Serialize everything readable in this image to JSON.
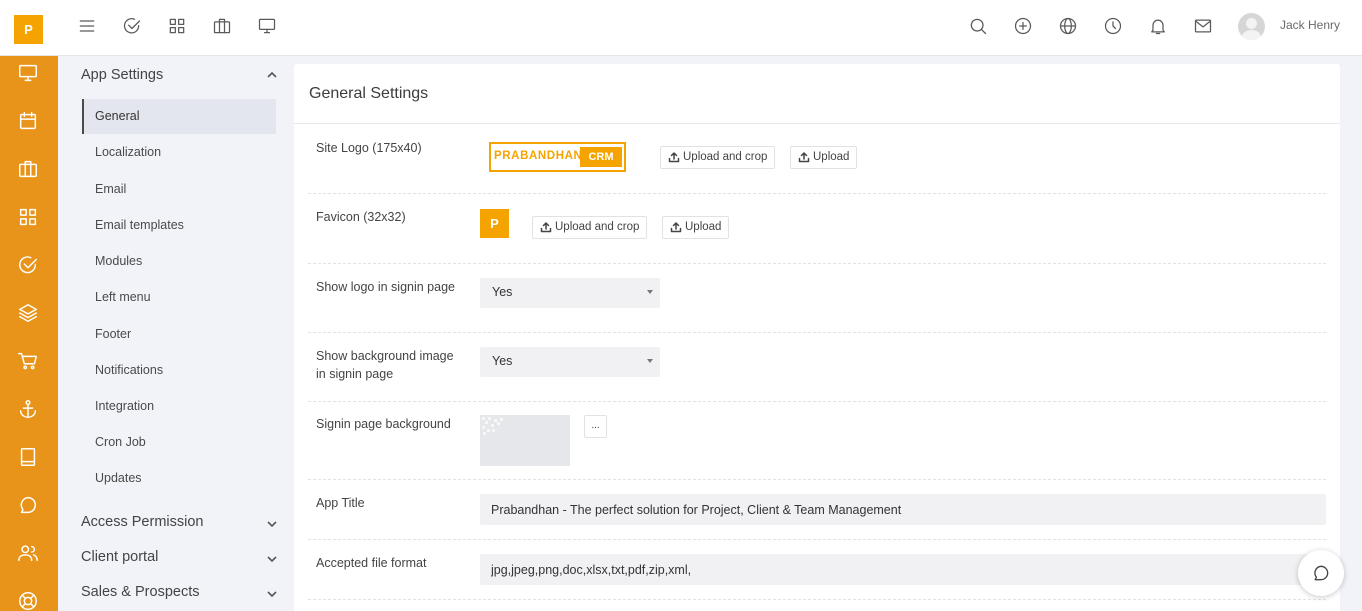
{
  "brand": {
    "letter": "P"
  },
  "rail": {
    "items": [
      "monitor-icon",
      "calendar-icon",
      "briefcase-icon",
      "grid-icon",
      "check-circle-icon",
      "layers-icon",
      "cart-icon",
      "anchor-icon",
      "book-icon",
      "chat-icon",
      "users-icon",
      "lifebuoy-icon"
    ],
    "background": "#e8941a"
  },
  "topbar": {
    "left_icons": [
      "menu-icon",
      "check-circle-icon",
      "grid-icon",
      "briefcase-icon",
      "monitor-icon"
    ],
    "right_icons": [
      "search-icon",
      "plus-circle-icon",
      "globe-icon",
      "clock-icon",
      "bell-icon",
      "mail-icon"
    ],
    "user_name": "Jack Henry"
  },
  "submenu": {
    "app_settings": {
      "title": "App Settings",
      "items": [
        "General",
        "Localization",
        "Email",
        "Email templates",
        "Modules",
        "Left menu",
        "Footer",
        "Notifications",
        "Integration",
        "Cron Job",
        "Updates"
      ],
      "active": "General"
    },
    "sections": [
      "Access Permission",
      "Client portal",
      "Sales & Prospects"
    ]
  },
  "main": {
    "title": "General Settings",
    "site_logo": {
      "label": "Site Logo (175x40)",
      "logo_text": "PRABANDHAN",
      "logo_badge": "CRM",
      "upload_crop": "Upload and crop",
      "upload": "Upload"
    },
    "favicon": {
      "label": "Favicon (32x32)",
      "letter": "P",
      "upload_crop": "Upload and crop",
      "upload": "Upload"
    },
    "show_logo": {
      "label": "Show logo in signin page",
      "value": "Yes"
    },
    "show_bg": {
      "label": "Show background image in signin page",
      "value": "Yes"
    },
    "signin_bg": {
      "label": "Signin page background",
      "more": "..."
    },
    "app_title": {
      "label": "App Title",
      "value": "Prabandhan - The perfect solution for Project, Client & Team Management"
    },
    "file_format": {
      "label": "Accepted file format",
      "value": "jpg,jpeg,png,doc,xlsx,txt,pdf,zip,xml,"
    }
  },
  "colors": {
    "accent": "#f5a300",
    "rail": "#e8941a"
  }
}
